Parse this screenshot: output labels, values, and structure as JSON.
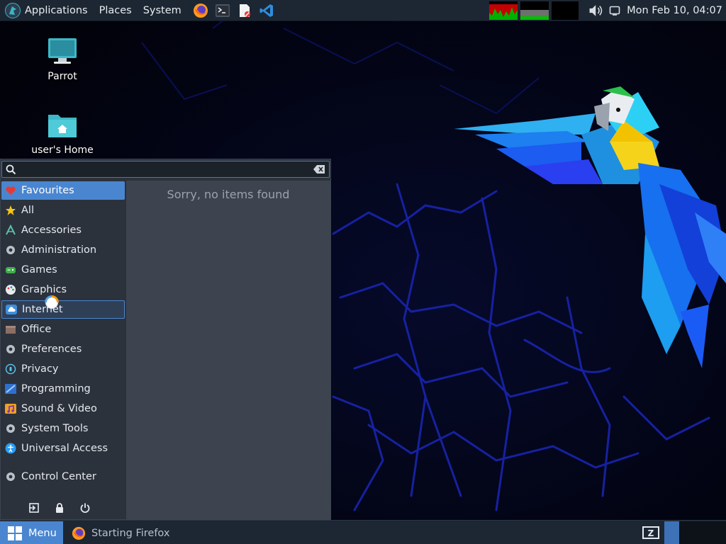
{
  "top_panel": {
    "menus": [
      "Applications",
      "Places",
      "System"
    ],
    "launchers": [
      {
        "name": "firefox-launcher",
        "icon": "firefox-icon"
      },
      {
        "name": "terminal-launcher",
        "icon": "terminal-icon"
      },
      {
        "name": "document-launcher",
        "icon": "document-icon"
      },
      {
        "name": "vscode-launcher",
        "icon": "vscode-icon"
      }
    ],
    "clock": "Mon Feb 10, 04:07",
    "tray_icons": [
      "cpu-graph",
      "memory-graph",
      "network-graph",
      "volume-icon",
      "screen-icon"
    ]
  },
  "desktop": {
    "icons": [
      {
        "label": "Parrot",
        "icon": "computer-icon"
      },
      {
        "label": "user's Home",
        "icon": "home-folder-icon"
      }
    ]
  },
  "menu": {
    "search": {
      "value": "",
      "placeholder": ""
    },
    "categories": [
      {
        "label": "Favourites",
        "icon": "heart-icon",
        "state": "active"
      },
      {
        "label": "All",
        "icon": "star-icon"
      },
      {
        "label": "Accessories",
        "icon": "accessories-icon"
      },
      {
        "label": "Administration",
        "icon": "gear-icon"
      },
      {
        "label": "Games",
        "icon": "gamepad-icon"
      },
      {
        "label": "Graphics",
        "icon": "palette-icon"
      },
      {
        "label": "Internet",
        "icon": "cloud-icon",
        "state": "hover"
      },
      {
        "label": "Office",
        "icon": "office-icon"
      },
      {
        "label": "Preferences",
        "icon": "gear-icon"
      },
      {
        "label": "Privacy",
        "icon": "privacy-icon"
      },
      {
        "label": "Programming",
        "icon": "programming-icon"
      },
      {
        "label": "Sound & Video",
        "icon": "music-icon"
      },
      {
        "label": "System Tools",
        "icon": "gear-icon"
      },
      {
        "label": "Universal Access",
        "icon": "accessibility-icon"
      },
      {
        "label": "Control Center",
        "icon": "gear-icon"
      }
    ],
    "empty_message": "Sorry, no items found",
    "session_buttons": [
      "logout-icon",
      "lock-icon",
      "power-icon"
    ]
  },
  "bottom_panel": {
    "menu_button": "Menu",
    "task": "Starting Firefox"
  },
  "colors": {
    "panel": "#1d2733",
    "accent": "#4a86d0",
    "menu_bg": "#2b323c",
    "content_bg": "#3d4450"
  }
}
